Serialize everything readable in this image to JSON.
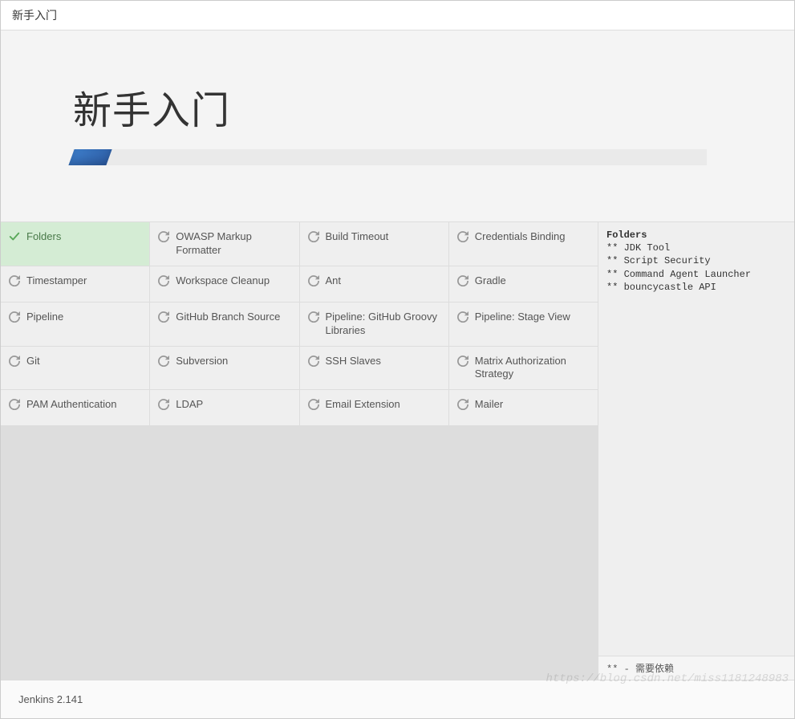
{
  "window": {
    "title": "新手入门"
  },
  "header": {
    "heading": "新手入门"
  },
  "progress": {
    "percent": 6
  },
  "plugins": [
    {
      "name": "Folders",
      "status": "success"
    },
    {
      "name": "OWASP Markup Formatter",
      "status": "pending"
    },
    {
      "name": "Build Timeout",
      "status": "pending"
    },
    {
      "name": "Credentials Binding",
      "status": "pending"
    },
    {
      "name": "Timestamper",
      "status": "pending"
    },
    {
      "name": "Workspace Cleanup",
      "status": "pending"
    },
    {
      "name": "Ant",
      "status": "pending"
    },
    {
      "name": "Gradle",
      "status": "pending"
    },
    {
      "name": "Pipeline",
      "status": "pending"
    },
    {
      "name": "GitHub Branch Source",
      "status": "pending"
    },
    {
      "name": "Pipeline: GitHub Groovy Libraries",
      "status": "pending"
    },
    {
      "name": "Pipeline: Stage View",
      "status": "pending"
    },
    {
      "name": "Git",
      "status": "pending"
    },
    {
      "name": "Subversion",
      "status": "pending"
    },
    {
      "name": "SSH Slaves",
      "status": "pending"
    },
    {
      "name": "Matrix Authorization Strategy",
      "status": "pending"
    },
    {
      "name": "PAM Authentication",
      "status": "pending"
    },
    {
      "name": "LDAP",
      "status": "pending"
    },
    {
      "name": "Email Extension",
      "status": "pending"
    },
    {
      "name": "Mailer",
      "status": "pending"
    }
  ],
  "log": {
    "heading": "Folders",
    "lines": [
      "** JDK Tool",
      "** Script Security",
      "** Command Agent Launcher",
      "** bouncycastle API"
    ],
    "legend": "** - 需要依赖"
  },
  "footer": {
    "version": "Jenkins 2.141"
  },
  "watermark": "https://blog.csdn.net/miss1181248983"
}
